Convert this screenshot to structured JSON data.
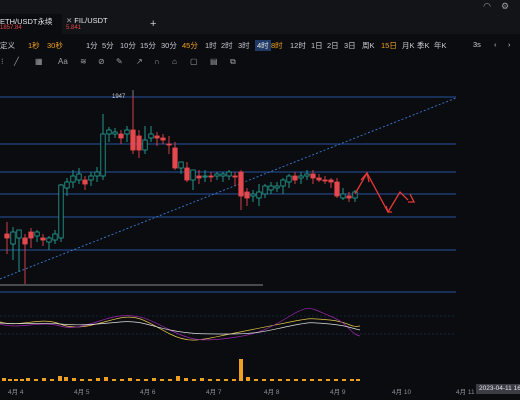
{
  "tabs": [
    {
      "name": "ETH/USDT永续",
      "price": "1857.84"
    },
    {
      "name": "FIL/USDT",
      "price": "5.841"
    }
  ],
  "add_tab": "+",
  "intervals": [
    {
      "label": "定义",
      "style": "normal"
    },
    {
      "label": "1秒",
      "style": "orange"
    },
    {
      "label": "30秒",
      "style": "orange"
    },
    {
      "label": "1分",
      "style": "normal"
    },
    {
      "label": "5分",
      "style": "normal"
    },
    {
      "label": "10分",
      "style": "normal"
    },
    {
      "label": "15分",
      "style": "normal"
    },
    {
      "label": "30分",
      "style": "normal"
    },
    {
      "label": "45分",
      "style": "orange"
    },
    {
      "label": "1时",
      "style": "normal"
    },
    {
      "label": "2时",
      "style": "normal"
    },
    {
      "label": "3时",
      "style": "normal"
    },
    {
      "label": "4时",
      "style": "selected"
    },
    {
      "label": "8时",
      "style": "orange"
    },
    {
      "label": "12时",
      "style": "normal"
    },
    {
      "label": "1日",
      "style": "normal"
    },
    {
      "label": "2日",
      "style": "normal"
    },
    {
      "label": "3日",
      "style": "normal"
    },
    {
      "label": "周K",
      "style": "normal"
    },
    {
      "label": "15日",
      "style": "orange"
    },
    {
      "label": "月K",
      "style": "normal"
    },
    {
      "label": "季K",
      "style": "normal"
    },
    {
      "label": "年K",
      "style": "normal"
    },
    {
      "label": "3s",
      "style": "normal"
    }
  ],
  "toolbar": {
    "text_tool_label": "Aa"
  },
  "chart_data": {
    "type": "candlestick",
    "high_marker_label": "1947",
    "x_ticks": [
      "4月 4",
      "4月 5",
      "4月 6",
      "4月 7",
      "4月 8",
      "4月 9",
      "4月 10",
      "4月 11"
    ],
    "time_badge": "2023-04-11 16",
    "colors": {
      "up": "#26a69a",
      "down": "#e5484d",
      "level_lines": "#2f6ad0",
      "trend_line": "#3a7bd5",
      "annotation": "#e53935"
    },
    "macd_lines": [
      "#e6c84a",
      "#9c27b0",
      "#e0e0e0"
    ],
    "volume_bar_color": "#f0a020",
    "note": ""
  }
}
